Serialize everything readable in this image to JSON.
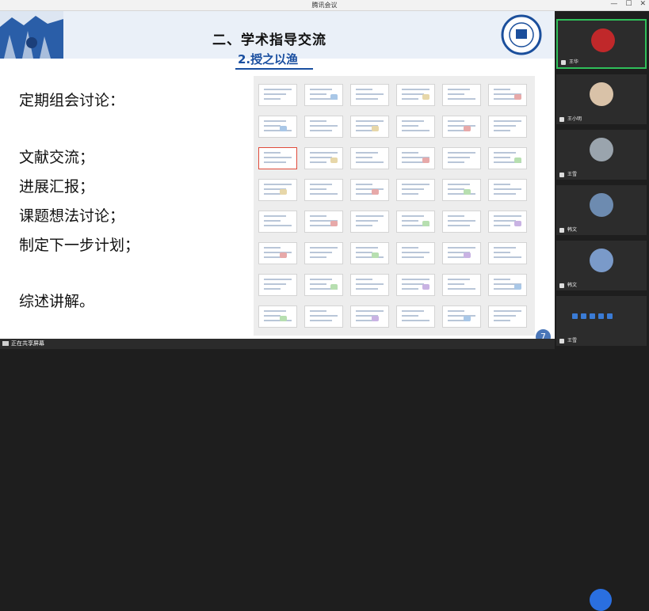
{
  "window": {
    "title": "腾讯会议"
  },
  "slide": {
    "heading": "二、学术指导交流",
    "subheading": "2.授之以渔",
    "bullets": [
      "定期组会讨论：",
      "文献交流；",
      "进展汇报；",
      "课题想法讨论；",
      "制定下一步计划；",
      "综述讲解。"
    ],
    "page_number": "7"
  },
  "bottombar": {
    "sharing_text": "正在共享屏幕"
  },
  "participants": [
    {
      "name": "王华",
      "avatar_color": "#c0282a"
    },
    {
      "name": "王小明",
      "avatar_color": "#d9c2a8"
    },
    {
      "name": "王雪",
      "avatar_color": "#9aa4ad"
    },
    {
      "name": "韩文",
      "avatar_color": "#6d8bb0"
    },
    {
      "name": "韩文",
      "avatar_color": "#7a9ac9"
    },
    {
      "name": "王雪",
      "avatar_color": "#3a78e0"
    }
  ],
  "colors": {
    "accent": "#1a4fa0",
    "active_speaker": "#2fbf5a"
  }
}
